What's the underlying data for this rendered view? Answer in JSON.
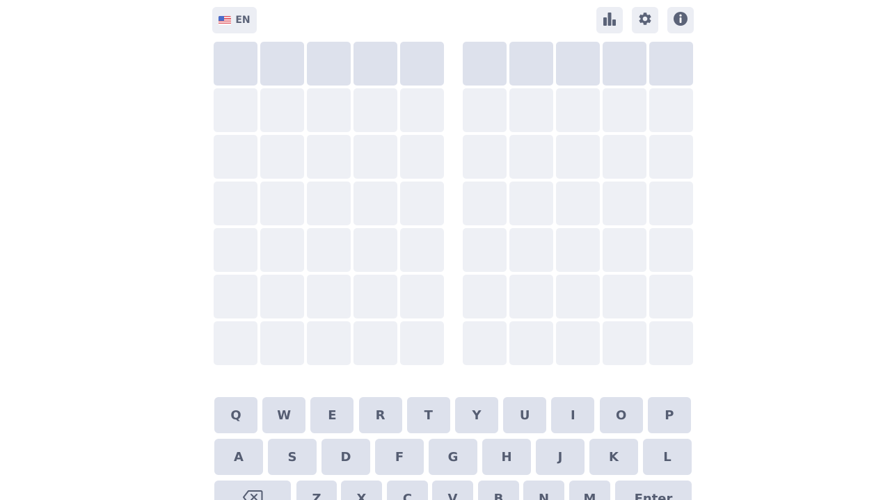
{
  "header": {
    "language_label": "EN",
    "language_flag": "us-flag-icon",
    "stats_icon": "bar-chart-icon",
    "settings_icon": "gear-icon",
    "info_icon": "info-icon"
  },
  "boards": {
    "count": 2,
    "rows": 7,
    "columns": 5,
    "active_row": 0,
    "left_tiles": [
      [
        "",
        "",
        "",
        "",
        ""
      ],
      [
        "",
        "",
        "",
        "",
        ""
      ],
      [
        "",
        "",
        "",
        "",
        ""
      ],
      [
        "",
        "",
        "",
        "",
        ""
      ],
      [
        "",
        "",
        "",
        "",
        ""
      ],
      [
        "",
        "",
        "",
        "",
        ""
      ],
      [
        "",
        "",
        "",
        "",
        ""
      ]
    ],
    "right_tiles": [
      [
        "",
        "",
        "",
        "",
        ""
      ],
      [
        "",
        "",
        "",
        "",
        ""
      ],
      [
        "",
        "",
        "",
        "",
        ""
      ],
      [
        "",
        "",
        "",
        "",
        ""
      ],
      [
        "",
        "",
        "",
        "",
        ""
      ],
      [
        "",
        "",
        "",
        "",
        ""
      ],
      [
        "",
        "",
        "",
        "",
        ""
      ]
    ]
  },
  "keyboard": {
    "row1": [
      "Q",
      "W",
      "E",
      "R",
      "T",
      "Y",
      "U",
      "I",
      "O",
      "P"
    ],
    "row2": [
      "A",
      "S",
      "D",
      "F",
      "G",
      "H",
      "J",
      "K",
      "L"
    ],
    "row3": [
      "backspace-icon",
      "Z",
      "X",
      "C",
      "V",
      "B",
      "N",
      "M",
      "Enter"
    ]
  },
  "colors": {
    "tile_empty": "#eef0f5",
    "tile_active_row": "#dde1ec",
    "key_background": "#dde1ec",
    "key_text": "#555d72",
    "header_button_background": "#eceef4",
    "icon_color": "#5b6378"
  }
}
